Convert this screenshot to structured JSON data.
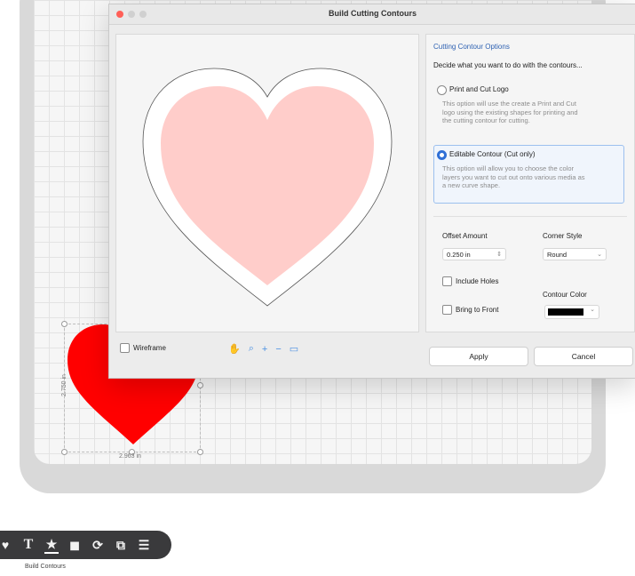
{
  "dialog": {
    "title": "Build Cutting Contours",
    "wireframe_label": "Wireframe",
    "preview_tools": [
      "hand-icon",
      "zoom-icon",
      "plus-icon",
      "minus-icon",
      "fit-icon"
    ]
  },
  "options": {
    "heading": "Cutting Contour Options",
    "prompt": "Decide what you want to do with the contours...",
    "print_cut": {
      "label": "Print and Cut Logo",
      "desc1": "This option will use the create a Print and Cut",
      "desc2": "logo using the existing shapes for printing and",
      "desc3": "the cutting contour for cutting.",
      "selected": false
    },
    "editable": {
      "label": "Editable Contour (Cut only)",
      "desc1": "This option will allow you to choose the color",
      "desc2": "layers you want to cut out onto various media  as",
      "desc3": "a new curve shape.",
      "selected": true
    },
    "offset_label": "Offset Amount",
    "offset_value": "0.250 in",
    "corner_label": "Corner Style",
    "corner_value": "Round",
    "include_holes_label": "Include Holes",
    "bring_front_label": "Bring to Front",
    "contour_color_label": "Contour Color",
    "contour_color": "#000000",
    "apply_label": "Apply",
    "cancel_label": "Cancel"
  },
  "canvas": {
    "width_dim": "2.963 in",
    "height_dim": "2.750 in",
    "heart_color": "#ff0000"
  },
  "toolbar": {
    "tools": [
      "heart-icon",
      "text-icon",
      "star-icon",
      "shape-icon",
      "rotate-icon",
      "combine-icon",
      "align-icon"
    ],
    "tooltip": "Build Contours"
  },
  "colors": {
    "accent": "#2f6fd6",
    "heart_fill": "#ffcdca"
  }
}
